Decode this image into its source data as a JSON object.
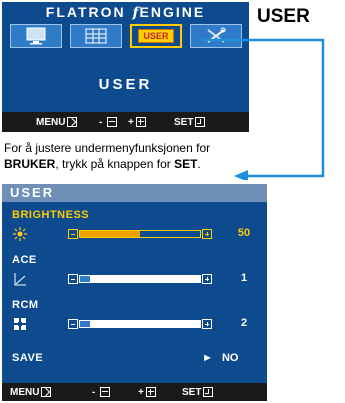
{
  "top_osd": {
    "brand_left": "FLATRON",
    "brand_f": "f",
    "brand_right": "ENGINE",
    "tabs": [
      {
        "icon": "monitor-icon"
      },
      {
        "icon": "grid-icon"
      },
      {
        "icon": "user-tab",
        "label": "USER"
      },
      {
        "icon": "tools-icon"
      }
    ],
    "title": "USER",
    "bottom_bar": {
      "menu": "MENU",
      "minus": "-",
      "plus": "+",
      "set": "SET"
    }
  },
  "heading": "USER",
  "instruction": {
    "line1": "For å justere undermenyfunksjonen for",
    "bold1": "BRUKER",
    "mid": ", trykk på knappen for ",
    "bold2": "SET",
    "end": "."
  },
  "user_menu": {
    "title": "USER",
    "rows": [
      {
        "label": "BRIGHTNESS",
        "icon": "sun-icon",
        "value": "50",
        "level": 50,
        "active": true
      },
      {
        "label": "ACE",
        "icon": "ace-icon",
        "value": "1",
        "level": 8,
        "active": false
      },
      {
        "label": "RCM",
        "icon": "rcm-icon",
        "value": "2",
        "level": 8,
        "active": false
      }
    ],
    "save": {
      "label": "SAVE",
      "arrow": "►",
      "value": "NO"
    },
    "bottom_bar": {
      "menu": "MENU",
      "minus": "-",
      "plus": "+",
      "set": "SET"
    }
  },
  "colors": {
    "osd_blue": "#0d4a8e",
    "accent_yellow": "#ffcc00",
    "arrow_blue": "#1e8fd8"
  }
}
